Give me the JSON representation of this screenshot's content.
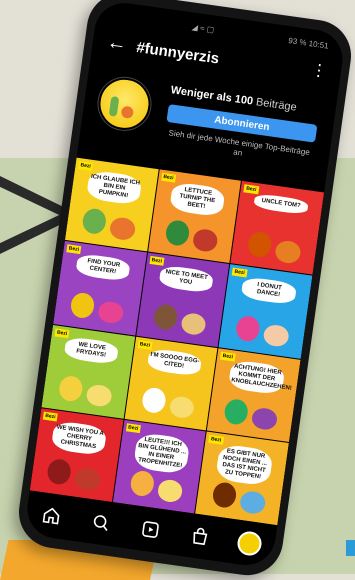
{
  "status": {
    "right": "93 %  10:51"
  },
  "header": {
    "title": "#funnyerzis",
    "back_icon": "arrow-left-icon",
    "more_icon": "vertical-dots-icon"
  },
  "profile": {
    "count_bold": "Weniger als 100",
    "count_unit": " Beiträge",
    "follow_label": "Abonnieren",
    "description": "Sieh dir jede Woche einige Top-Beiträge an"
  },
  "grid": {
    "tiles": [
      {
        "bubble": "ICH GLAUBE ICH BIN EIN PUMPKIN!",
        "bg": "#f7cf1e"
      },
      {
        "bubble": "LETTUCE TURNIP THE BEET!",
        "bg": "#f4942a"
      },
      {
        "bubble": "UNCLE TOM?",
        "bg": "#e8322f"
      },
      {
        "bubble": "FIND YOUR CENTER!",
        "bg": "#9a44c2"
      },
      {
        "bubble": "NICE TO MEET YOU",
        "bg": "#8d39b7"
      },
      {
        "bubble": "I DONUT DANCE!",
        "bg": "#27a5e6"
      },
      {
        "bubble": "WE LOVE FRYDAYS!",
        "bg": "#9fcc39"
      },
      {
        "bubble": "I'M SOOOO EGG-CITED!",
        "bg": "#f5c41d"
      },
      {
        "bubble": "ACHTUNG! HIER KOMMT DER KNOBLAUCHZEHEN!",
        "bg": "#f3a22a"
      },
      {
        "bubble": "WE WISH YOU A CHERRY CHRISTMAS",
        "bg": "#e3262c"
      },
      {
        "bubble": "LEUTE!!! ICH BIN GLÜHEND ... IN EINER TROPENHITZE!",
        "bg": "#9c3fbf"
      },
      {
        "bubble": "ES GIBT NUR NOCH EINEN ... DAS IST NICHT ZU TOPPEN!",
        "bg": "#f4b327"
      }
    ],
    "badge": "Bezi"
  },
  "nav": {
    "items": [
      "home-icon",
      "search-icon",
      "reels-icon",
      "shop-icon",
      "profile-avatar"
    ]
  },
  "colors": {
    "accent": "#3c95ef",
    "background": "#000000"
  }
}
